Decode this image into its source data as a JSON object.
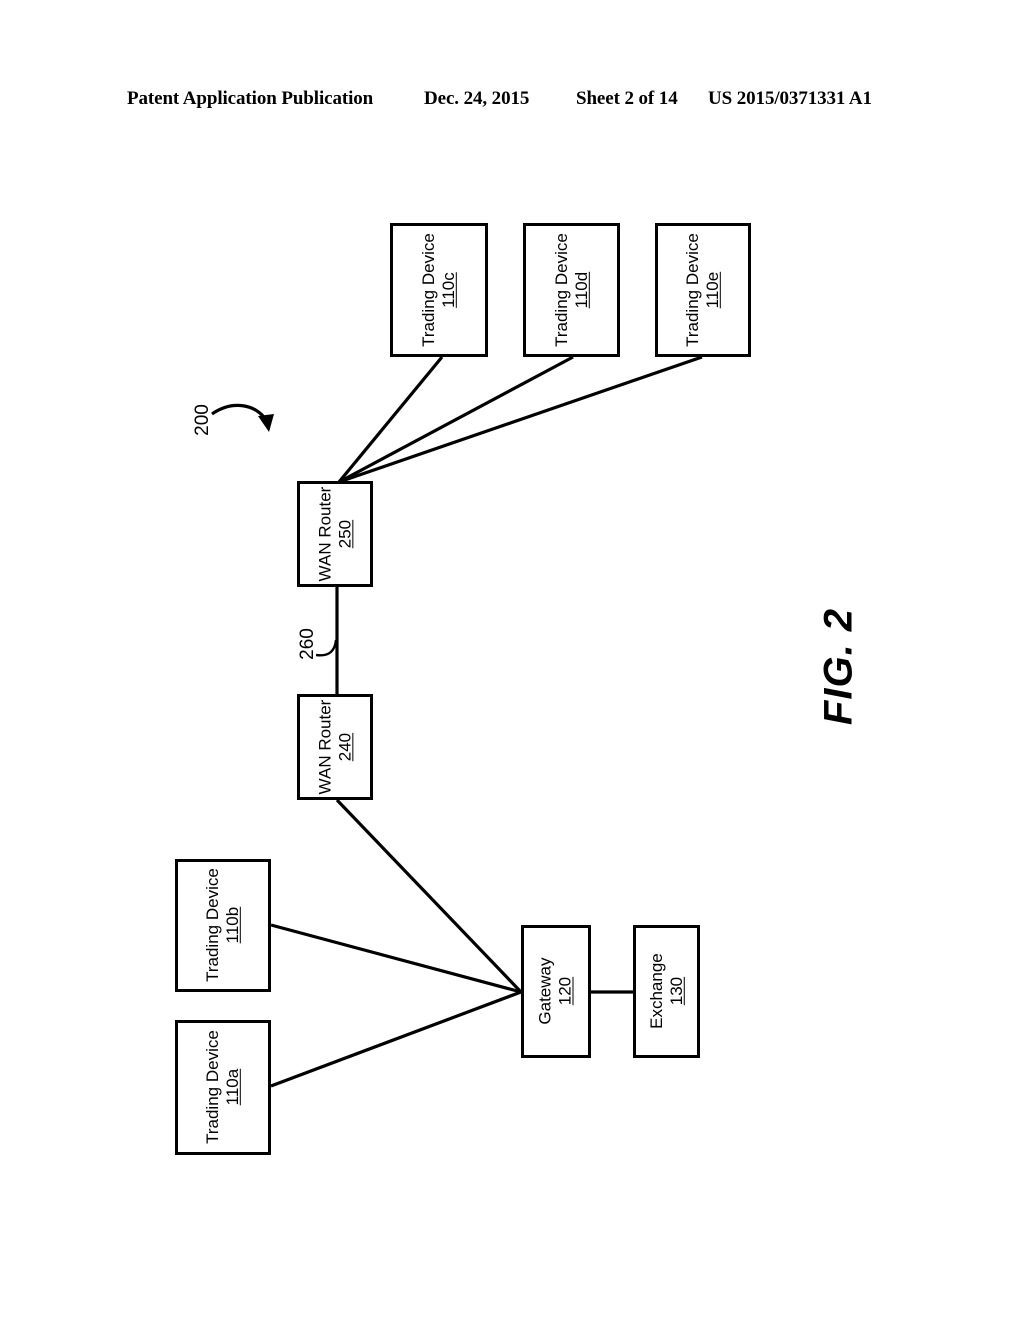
{
  "header": {
    "publication": "Patent Application Publication",
    "date": "Dec. 24, 2015",
    "sheet": "Sheet 2 of 14",
    "number": "US 2015/0371331 A1"
  },
  "figure": {
    "label": "FIG. 2",
    "system_ref": "200",
    "link_ref": "260"
  },
  "nodes": {
    "trading_device_c": {
      "title": "Trading Device",
      "ref": "110c"
    },
    "trading_device_d": {
      "title": "Trading Device",
      "ref": "110d"
    },
    "trading_device_e": {
      "title": "Trading Device",
      "ref": "110e"
    },
    "wan_router_250": {
      "title": "WAN Router",
      "ref": "250"
    },
    "wan_router_240": {
      "title": "WAN Router",
      "ref": "240"
    },
    "trading_device_b": {
      "title": "Trading Device",
      "ref": "110b"
    },
    "trading_device_a": {
      "title": "Trading Device",
      "ref": "110a"
    },
    "gateway": {
      "title": "Gateway",
      "ref": "120"
    },
    "exchange": {
      "title": "Exchange",
      "ref": "130"
    }
  },
  "colors": {
    "line": "#000000",
    "background": "#ffffff"
  }
}
